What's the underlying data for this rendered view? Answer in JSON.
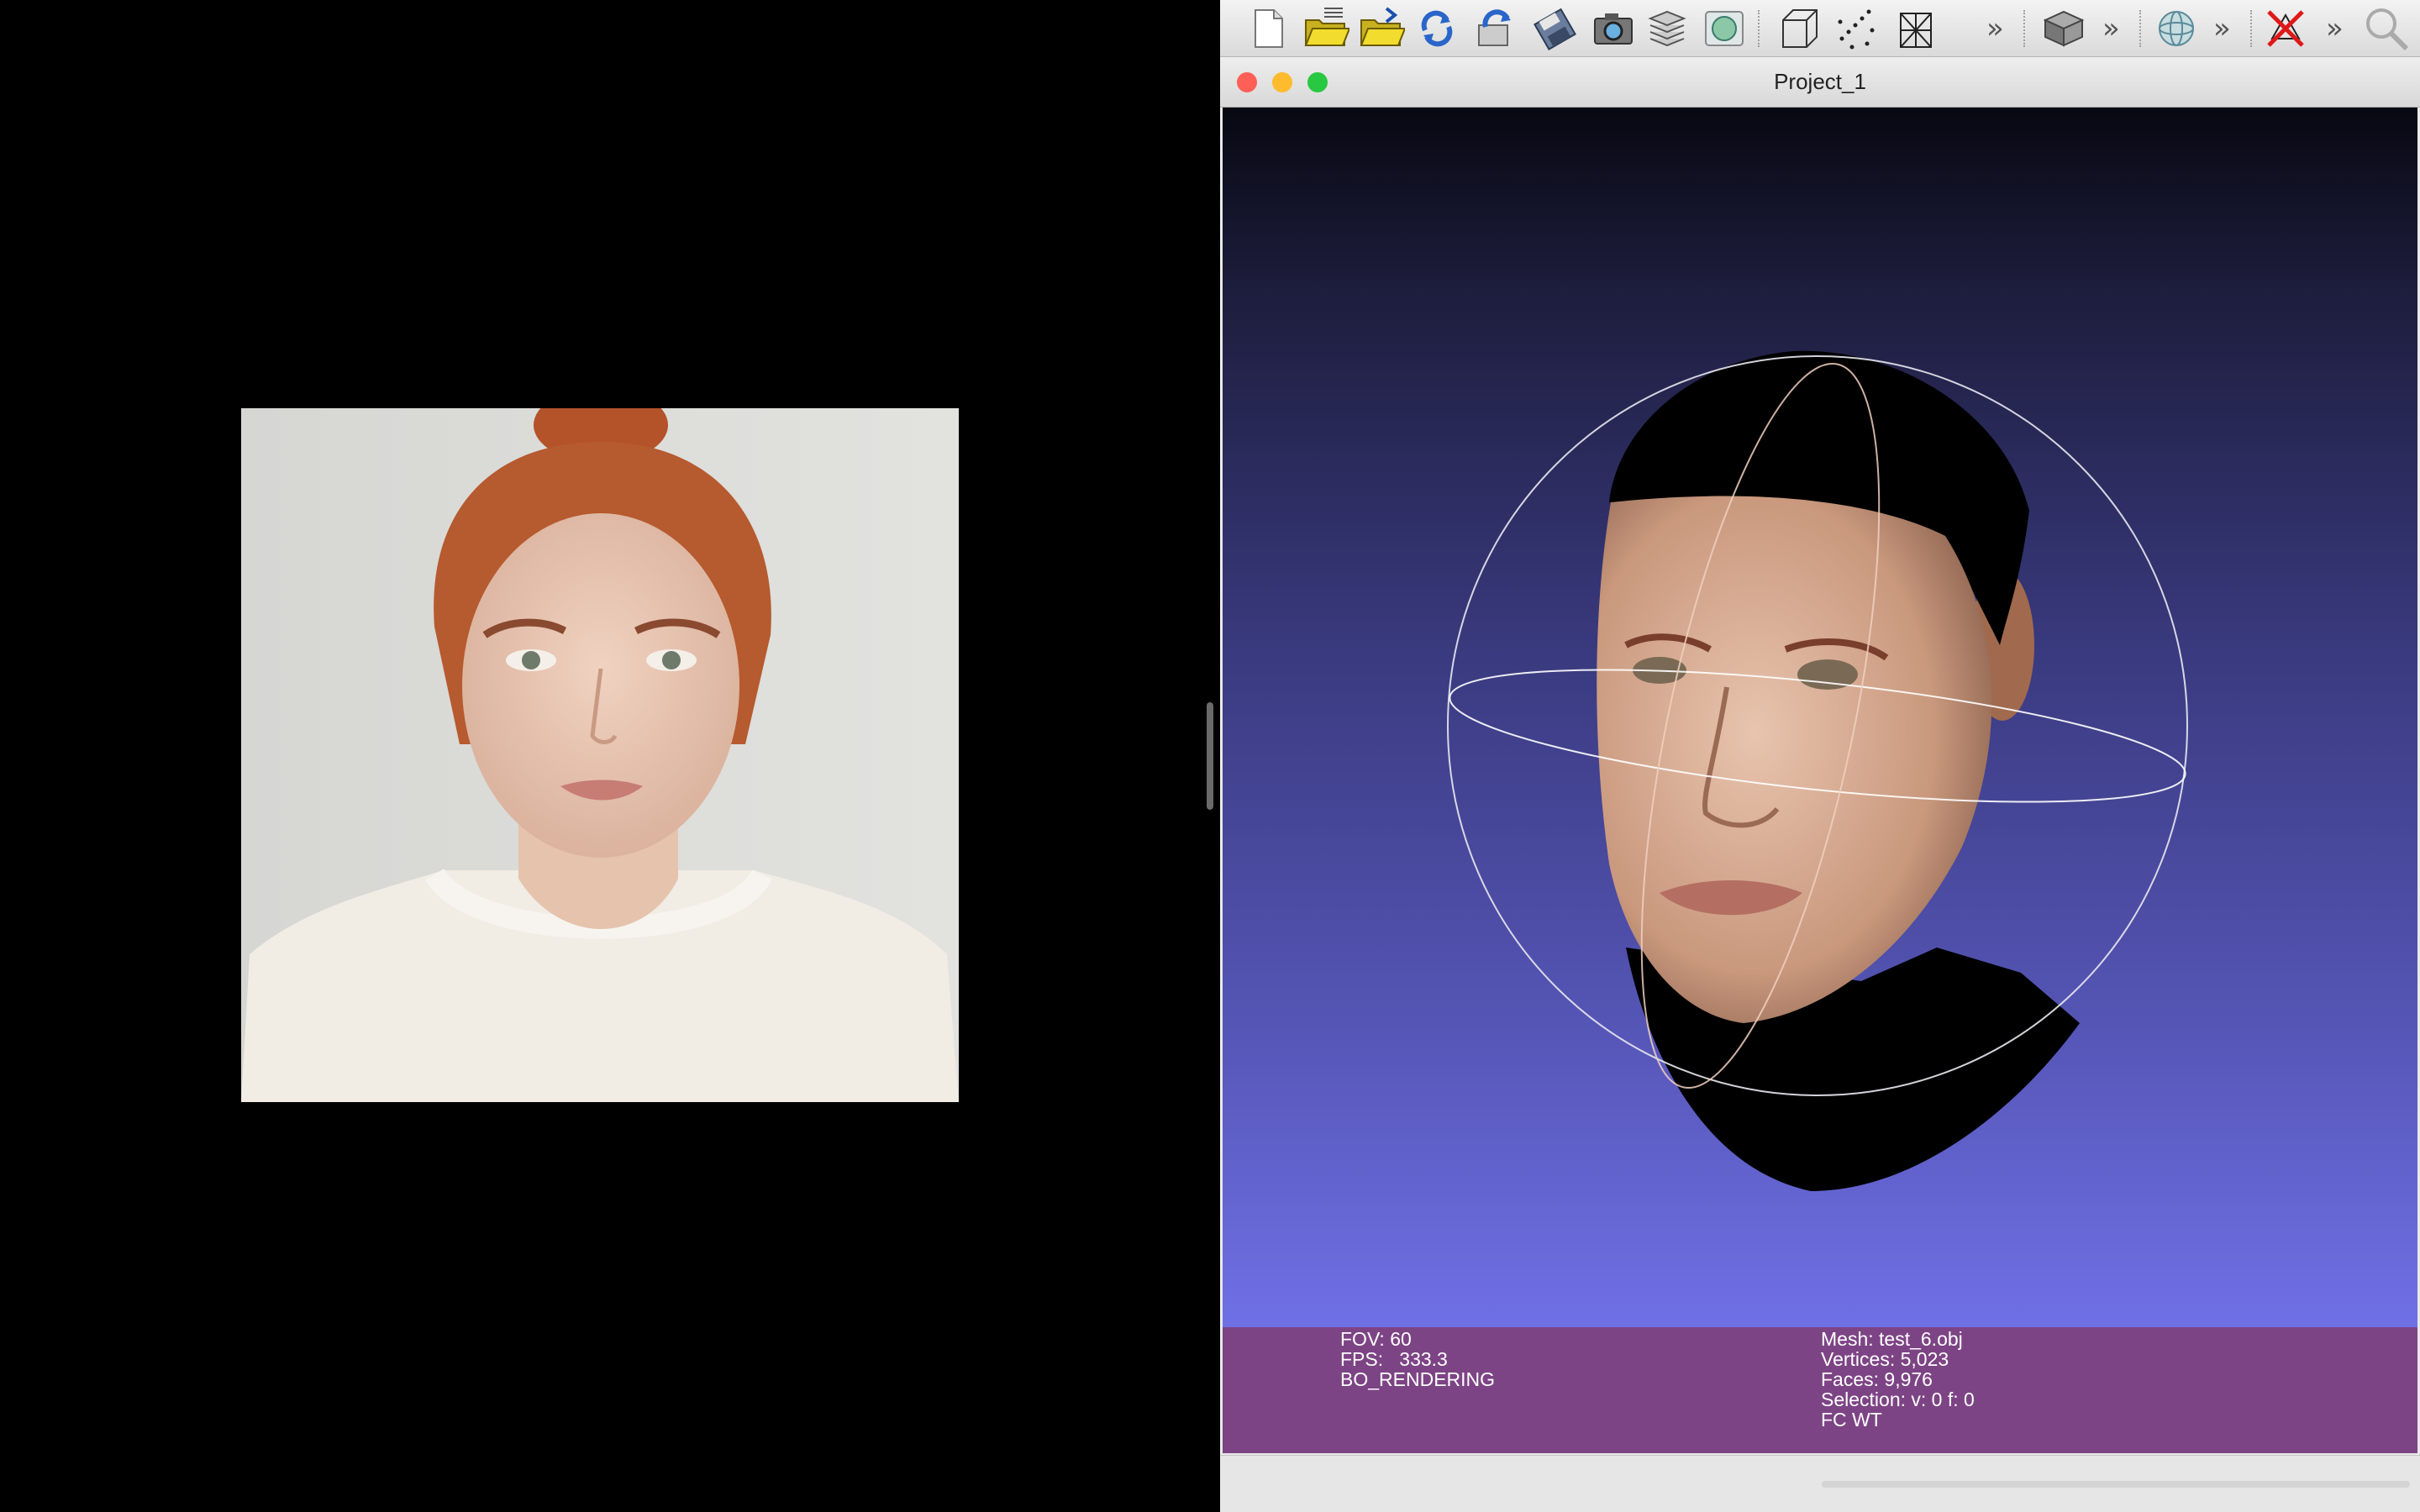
{
  "window": {
    "title": "Project_1"
  },
  "toolbar": {
    "icons": [
      "new-document-icon",
      "open-project-icon",
      "import-mesh-icon",
      "reload-icon",
      "reload-all-icon",
      "save-icon",
      "snapshot-icon",
      "layers-icon",
      "raster-icon",
      "bounding-box-icon",
      "points-icon",
      "wireframe-icon",
      "render-mode-icon",
      "sphere-decorator-icon",
      "delete-selection-icon",
      "zoom-icon"
    ]
  },
  "info_bar": {
    "left": {
      "fov": "FOV: 60",
      "fps": "FPS:   333.3",
      "mode": "BO_RENDERING"
    },
    "right": {
      "mesh": "Mesh: test_6.obj",
      "vertices": "Vertices: 5,023",
      "faces": "Faces: 9,976",
      "selection": "Selection: v: 0 f: 0",
      "flags": "FC WT"
    }
  },
  "colors": {
    "info_bar_bg": "#7d4485",
    "viewport_top": "#080812",
    "viewport_bottom": "#7070e6",
    "close": "#fe5f57",
    "minimize": "#febb2e",
    "zoom": "#28c840"
  }
}
